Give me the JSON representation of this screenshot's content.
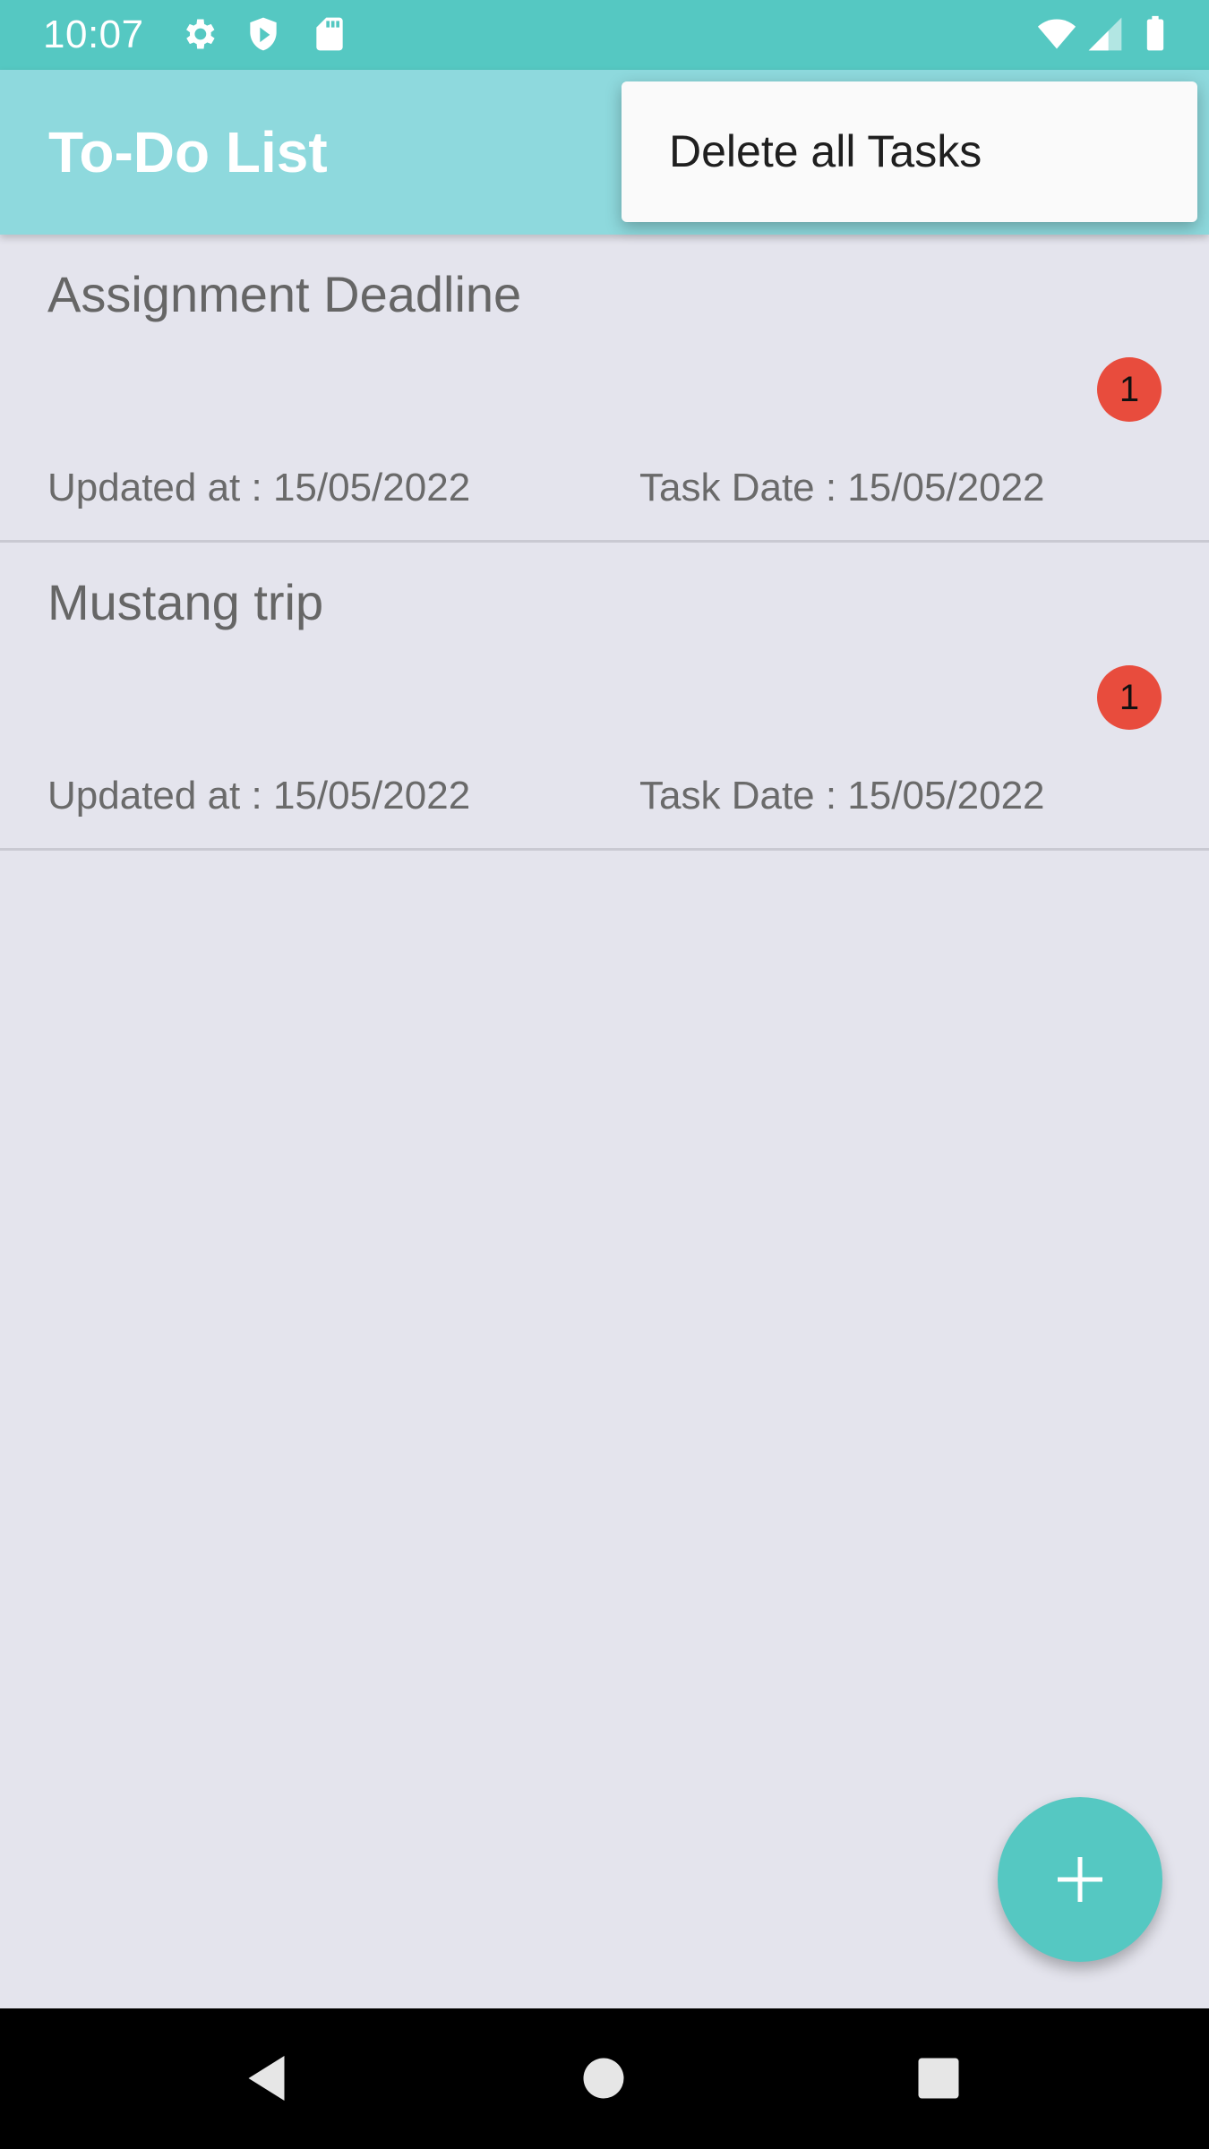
{
  "status_bar": {
    "time": "10:07",
    "left_icons": [
      "gear-icon",
      "shield-icon",
      "sd-card-icon"
    ],
    "right_icons": [
      "wifi-icon",
      "cell-signal-icon",
      "battery-icon"
    ]
  },
  "app_bar": {
    "title": "To-Do List"
  },
  "overflow_menu": {
    "items": [
      {
        "label": "Delete all Tasks"
      }
    ]
  },
  "tasks": [
    {
      "title": "Assignment Deadline",
      "badge": "1",
      "updated": "Updated at : 15/05/2022",
      "task_date": "Task Date : 15/05/2022"
    },
    {
      "title": "Mustang trip",
      "badge": "1",
      "updated": "Updated at : 15/05/2022",
      "task_date": "Task Date : 15/05/2022"
    }
  ],
  "fab": {
    "icon": "plus-icon"
  },
  "navigation": {
    "buttons": [
      "back-icon",
      "home-icon",
      "recents-icon"
    ]
  },
  "colors": {
    "status_bar": "#55c8c2",
    "app_bar": "#8ed9dd",
    "background": "#e4e4ed",
    "badge": "#e84c3d",
    "fab": "#55c8c2"
  }
}
